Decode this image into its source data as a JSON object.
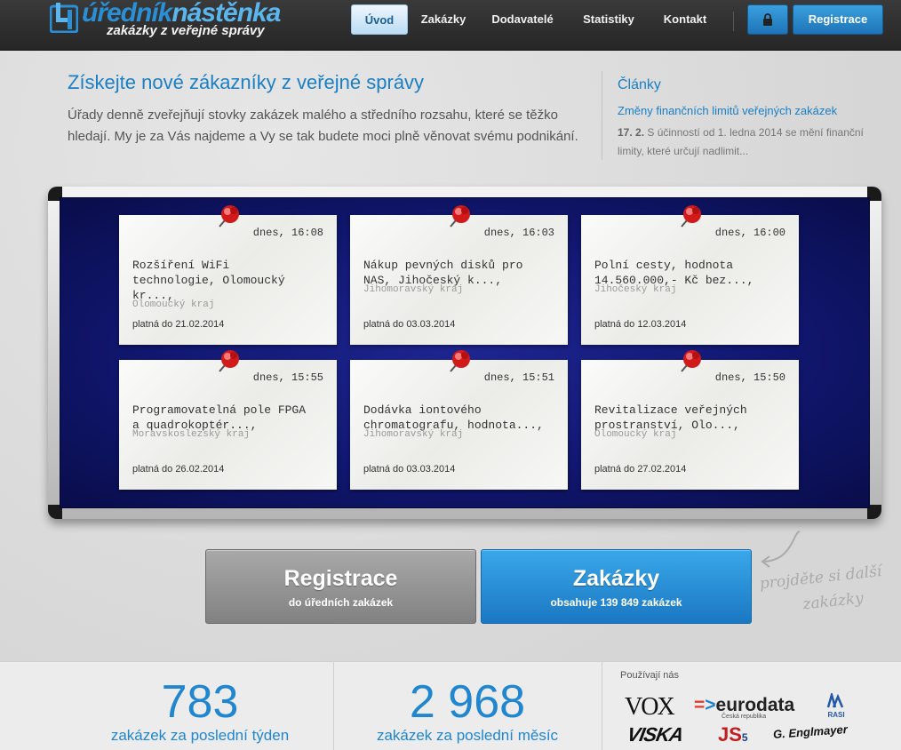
{
  "header": {
    "logo": {
      "main": "úředník",
      "accent": "nástěnka",
      "sub": "zakázky z veřejné správy"
    },
    "nav": [
      {
        "label": "Úvod",
        "active": true
      },
      {
        "label": "Zakázky",
        "active": false
      },
      {
        "label": "Dodavatelé",
        "active": false
      },
      {
        "label": "Statistiky",
        "active": false
      },
      {
        "label": "Kontakt",
        "active": false
      }
    ],
    "lock_icon": "lock-icon",
    "register_label": "Registrace"
  },
  "intro": {
    "headline": "Získejte nové zákazníky z veřejné správy",
    "text": "Úřady denně zveřejňují stovky zakázek malého a středního rozsahu, které se těžko hledají. My je za Vás najdeme a Vy se tak budete moci plně věnovat svému podnikání."
  },
  "articles": {
    "title": "Články",
    "link": "Změny finančních limitů veřejných zakázek",
    "date": "17. 2.",
    "text": "S účinností od 1. ledna 2014 se mění finanční limity, které určují nadlimit..."
  },
  "board": {
    "cards": [
      {
        "time": "dnes, 16:08",
        "title": "Rozšíření WiFi\ntechnologie, Olomoucký\nkr...,",
        "region": "Olomoucký kraj",
        "valid": "platná do 21.02.2014"
      },
      {
        "time": "dnes, 16:03",
        "title": "Nákup pevných disků pro\nNAS, Jihočeský k...,",
        "region": "Jihomoravský kraj",
        "valid": "platná do 03.03.2014"
      },
      {
        "time": "dnes, 16:00",
        "title": "Polní cesty, hodnota\n14.560.000,- Kč bez...,",
        "region": "Jihočeský kraj",
        "valid": "platná do 12.03.2014"
      },
      {
        "time": "dnes, 15:55",
        "title": "Programovatelná pole FPGA\na quadrokoptér...,",
        "region": "Moravskoslezský kraj",
        "valid": "platná do 26.02.2014"
      },
      {
        "time": "dnes, 15:51",
        "title": "Dodávka iontového\nchromatografu, hodnota...,",
        "region": "Jihomoravský kraj",
        "valid": "platná do 03.03.2014"
      },
      {
        "time": "dnes, 15:50",
        "title": "Revitalizace veřejných\nprostranství, Olo...,",
        "region": "Olomoucký kraj",
        "valid": "platná do 27.02.2014"
      }
    ]
  },
  "cta": {
    "register": {
      "title": "Registrace",
      "sub": "do úředních zakázek"
    },
    "tenders": {
      "title": "Zakázky",
      "sub": "obsahuje 139 849 zakázek"
    },
    "note_line1": "projděte si další",
    "note_line2": "zakázky"
  },
  "stats": {
    "week": {
      "value": "783",
      "label": "zakázek za poslední týden"
    },
    "month": {
      "value": "2 968",
      "label": "zakázek za poslední měsíc"
    }
  },
  "clients": {
    "title": "Používají nás",
    "logos": [
      "VOX",
      "eurodata",
      "Česká republika",
      "RASI",
      "VISKA",
      "JS",
      "5",
      "G. Englmayer"
    ]
  }
}
